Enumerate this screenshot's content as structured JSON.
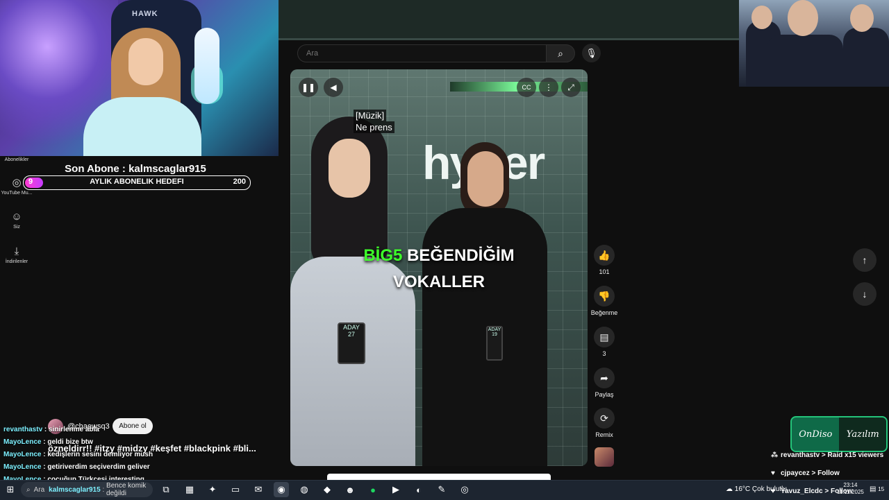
{
  "search": {
    "placeholder": "Ara"
  },
  "sidebar": {
    "items": [
      {
        "label": "Abonelikler",
        "icon": "subscriptions-icon"
      },
      {
        "label": "YouTube Mu...",
        "icon": "youtube-music-icon"
      },
      {
        "label": "Siz",
        "icon": "account-icon"
      },
      {
        "label": "İndirilenler",
        "icon": "download-icon"
      }
    ]
  },
  "stream_overlay": {
    "last_sub": "Son Abone : kalmscaglar915",
    "goal_label": "AYLIK ABONELIK HEDEFI",
    "goal_current": "9",
    "goal_target": "200",
    "goal_progress": 0.045,
    "webcam_brand": "HAWK"
  },
  "video": {
    "caption_line1": "[Müzik]",
    "caption_line2": "Ne prens",
    "overlay_green": "BİG5",
    "overlay_rest": "BEĞENDİĞİM",
    "overlay_line2": "VOKALLER",
    "sign_text": "hyper",
    "badge1": "ADAY 27",
    "badge2": "ADAY 19",
    "channel_handle": "@chaewsq3",
    "subscribe_label": "Abone ol",
    "hashtags": "özneldirr!! #itzy #midzy #keşfet #blackpink #bli..."
  },
  "actions": {
    "like_count": "101",
    "dislike_label": "Beğenme",
    "comments_count": "3",
    "share_label": "Paylaş",
    "remix_label": "Remix"
  },
  "chat": [
    {
      "user": "revanthastv",
      "text": "sinirlenme abla"
    },
    {
      "user": "MayoLence",
      "text": "geldi bize btw"
    },
    {
      "user": "MayoLence",
      "text": "kedişlerin sesini demliyor mush"
    },
    {
      "user": "MayoLence",
      "text": "getiriverdim seçiverdim geliver"
    },
    {
      "user": "MayoLence",
      "text": "cocuğun Türkçesi interesting"
    },
    {
      "user": "kalmscaglar915",
      "text": "Bence komik değildi"
    }
  ],
  "alerts": {
    "logo_left": "OnDiso",
    "logo_right": "Yazılım",
    "feed": [
      {
        "text": "revanthastv > Raid x15 viewers"
      },
      {
        "text": "cjpaycez > Follow"
      },
      {
        "text": "Yavuz_Elcdc > Follow"
      }
    ]
  },
  "taskbar": {
    "search_text": "Ara",
    "weather": "16°C",
    "weather_desc": "Çok bulutlu",
    "time": "23:14",
    "date": "11.11.2025",
    "notif_count": "15"
  }
}
